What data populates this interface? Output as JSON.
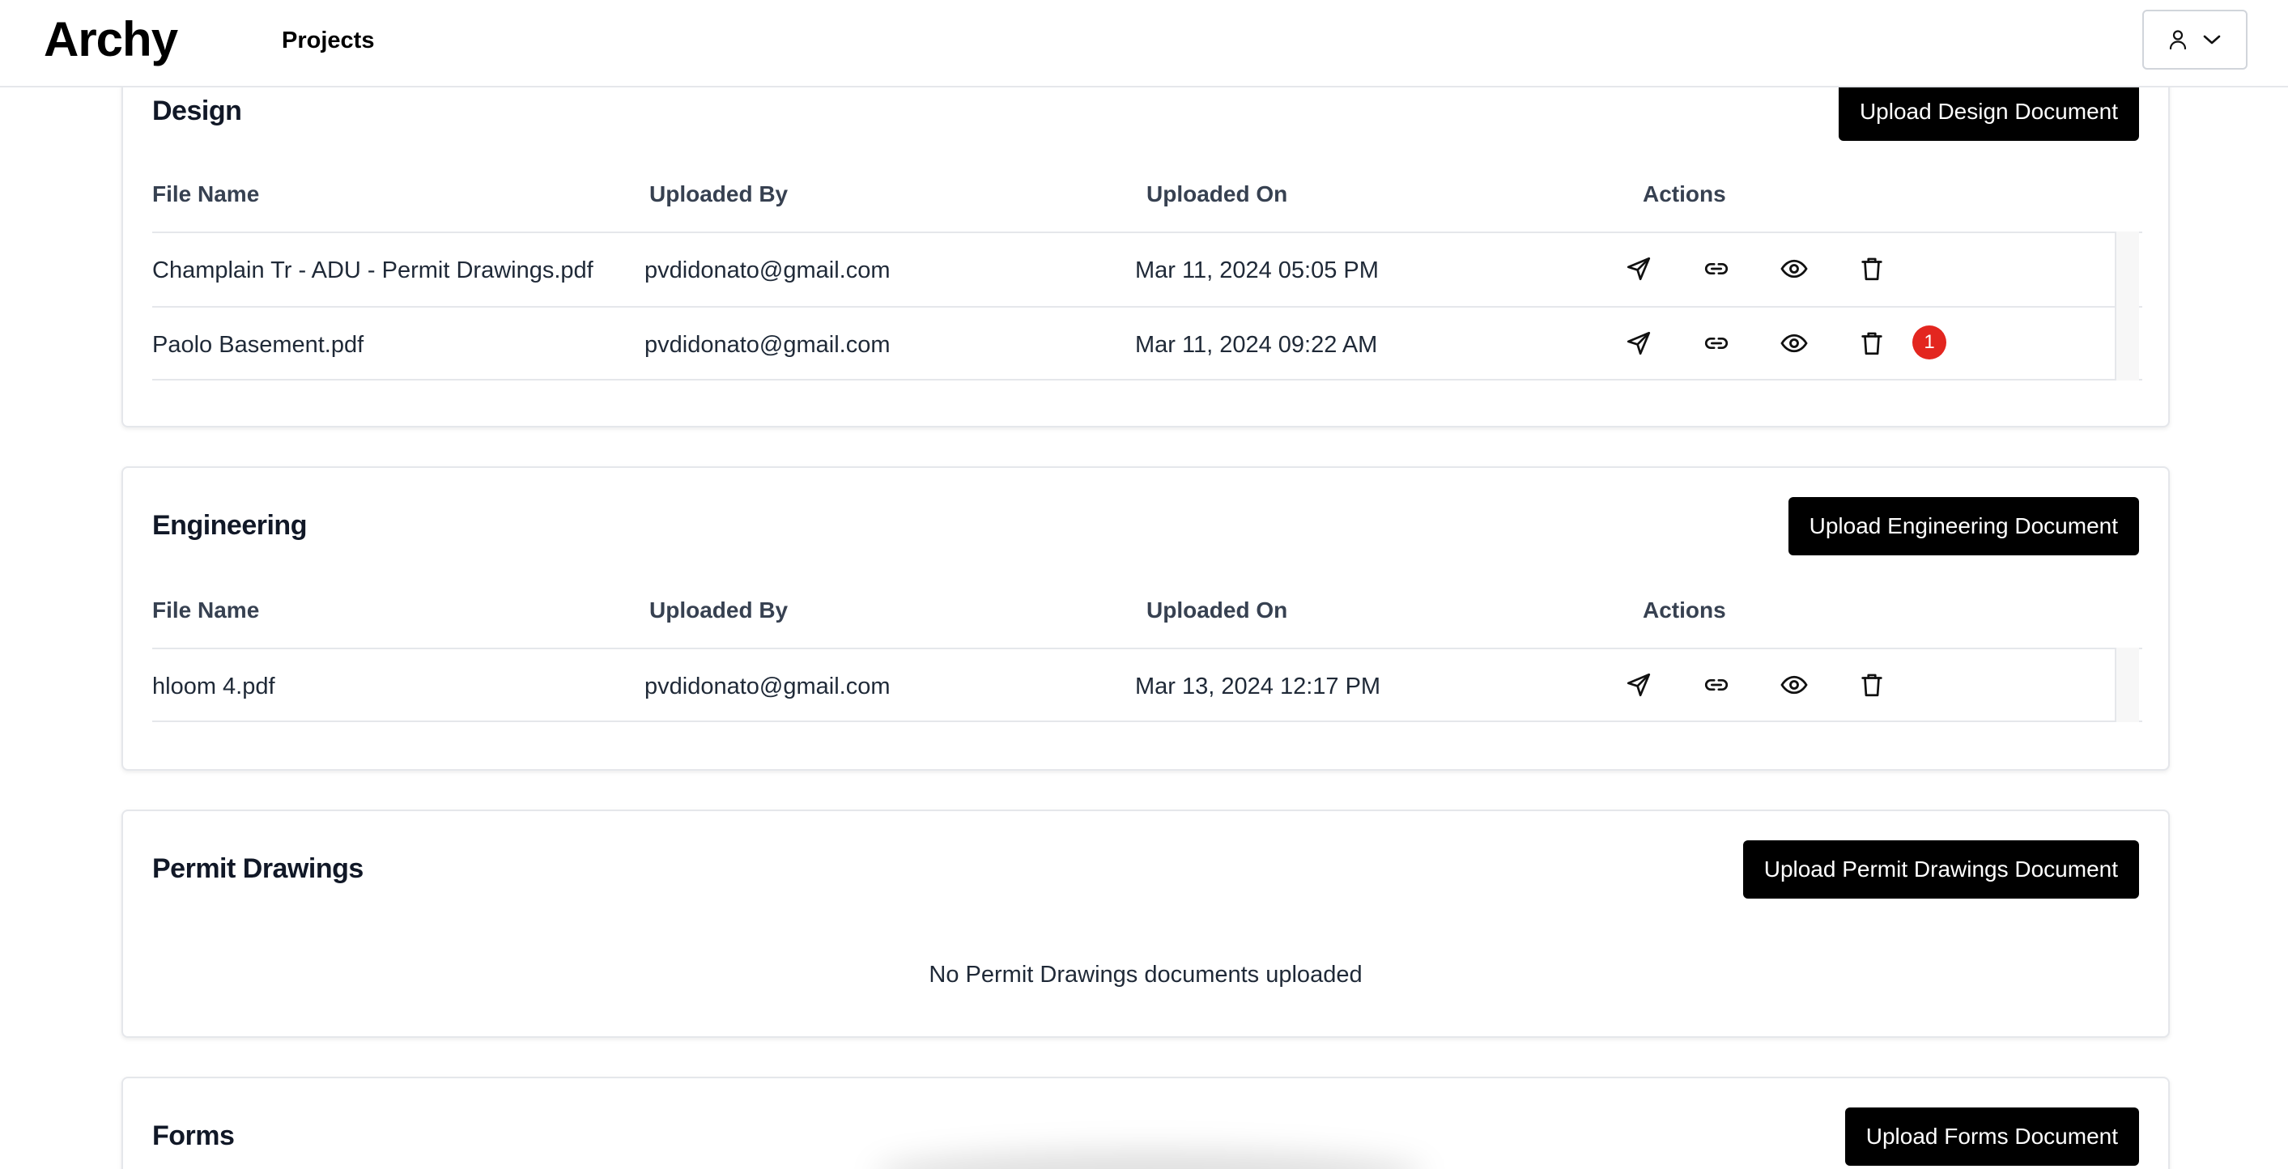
{
  "header": {
    "logo": "Archy",
    "nav_projects": "Projects"
  },
  "columns": {
    "file_name": "File Name",
    "uploaded_by": "Uploaded By",
    "uploaded_on": "Uploaded On",
    "actions": "Actions"
  },
  "design": {
    "title": "Design",
    "upload_label": "Upload Design Document",
    "rows": [
      {
        "file": "Champlain Tr - ADU - Permit Drawings.pdf",
        "by": "pvdidonato@gmail.com",
        "on": "Mar 11, 2024 05:05 PM"
      },
      {
        "file": "Paolo Basement.pdf",
        "by": "pvdidonato@gmail.com",
        "on": "Mar 11, 2024 09:22 AM",
        "badge": "1"
      }
    ]
  },
  "engineering": {
    "title": "Engineering",
    "upload_label": "Upload Engineering Document",
    "rows": [
      {
        "file": "hloom 4.pdf",
        "by": "pvdidonato@gmail.com",
        "on": "Mar 13, 2024 12:17 PM"
      }
    ]
  },
  "permit": {
    "title": "Permit Drawings",
    "upload_label": "Upload Permit Drawings Document",
    "empty": "No Permit Drawings documents uploaded"
  },
  "forms": {
    "title": "Forms",
    "upload_label": "Upload Forms Document"
  },
  "icons": [
    "send-icon",
    "link-icon",
    "eye-icon",
    "trash-icon",
    "user-icon",
    "chevron-down-icon"
  ],
  "colors": {
    "primary_button": "#000000",
    "badge": "#e3261f"
  }
}
